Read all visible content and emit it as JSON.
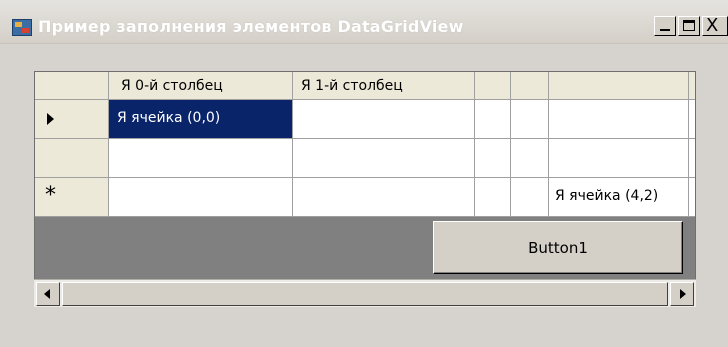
{
  "window": {
    "title": "Пример  заполнения элементов DataGridView",
    "controls": {
      "minimize": "minimize-icon",
      "maximize": "maximize-icon",
      "close_label": "X"
    }
  },
  "grid": {
    "columns": [
      "Я 0-й столбец",
      "Я 1-й столбец",
      "",
      "",
      ""
    ],
    "rows": [
      {
        "marker": "current-row-arrow-icon",
        "cells": [
          "Я ячейка (0,0)",
          "",
          "",
          "",
          ""
        ]
      },
      {
        "marker": "",
        "cells": [
          "",
          "",
          "",
          "",
          ""
        ]
      },
      {
        "marker": "*",
        "cells": [
          "",
          "",
          "",
          "",
          "Я ячейка (4,2)"
        ]
      }
    ],
    "selected_cell": "Я ячейка (0,0)",
    "selection_color": "#0a246a"
  },
  "button1": {
    "label": "Button1"
  },
  "scrollbar": {
    "left_icon": "scroll-left-icon",
    "right_icon": "scroll-right-icon"
  }
}
